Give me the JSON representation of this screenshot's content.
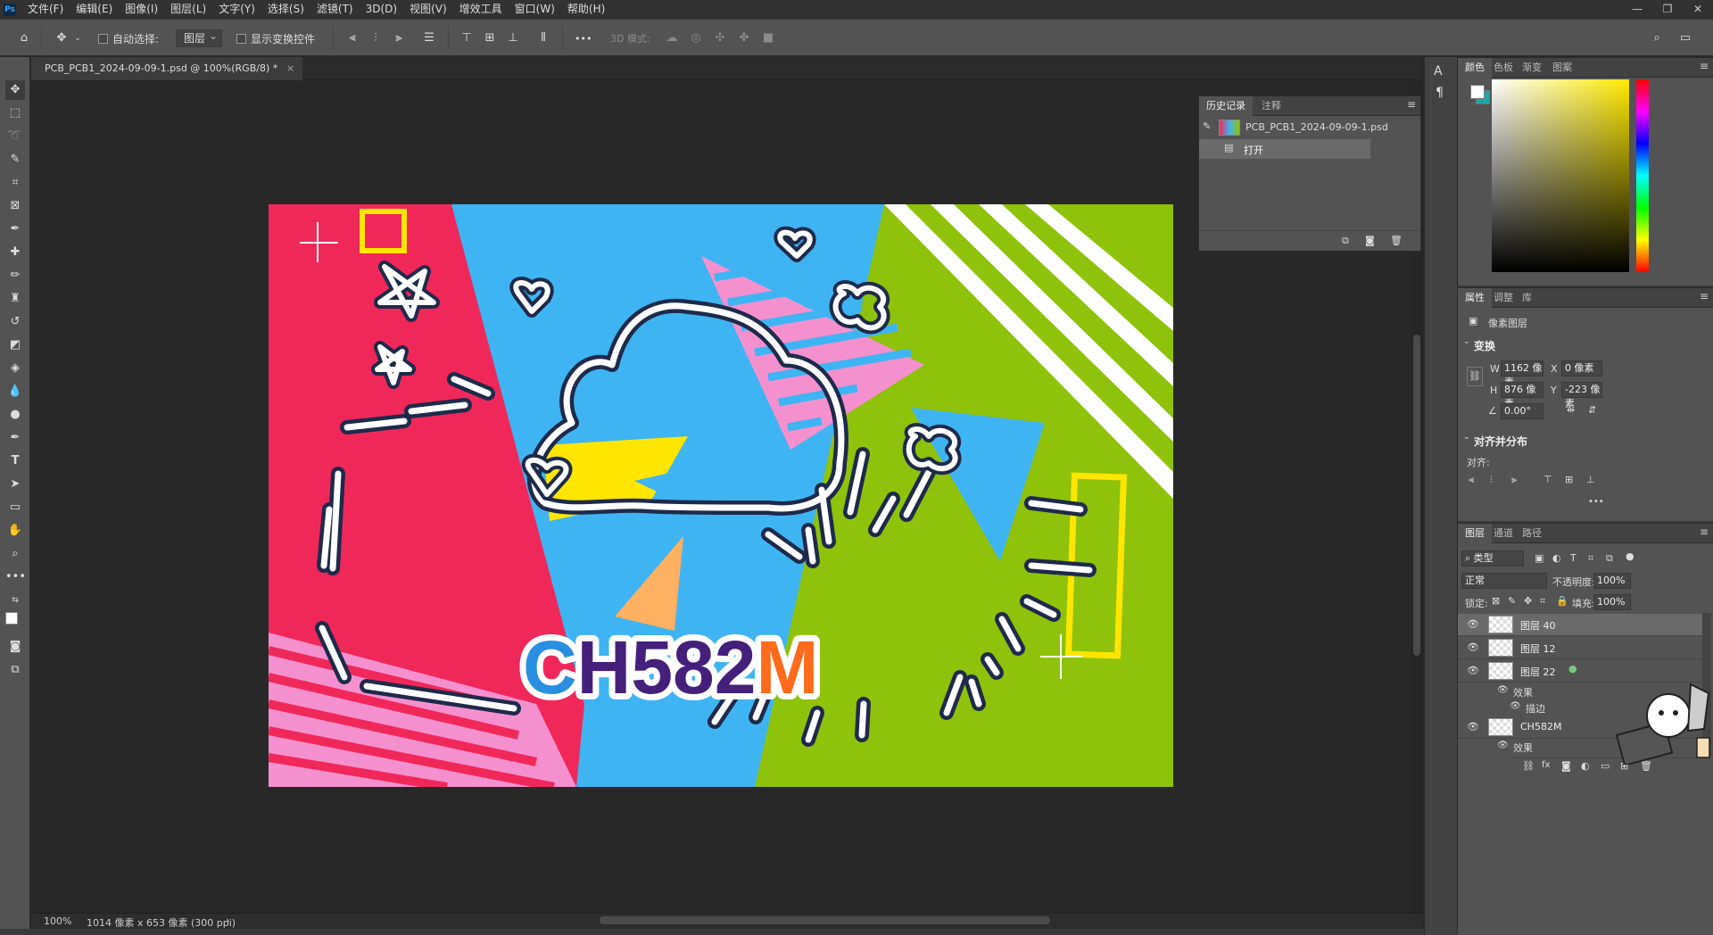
{
  "app": {
    "logo": "Ps"
  },
  "menu": [
    "文件(F)",
    "编辑(E)",
    "图像(I)",
    "图层(L)",
    "文字(Y)",
    "选择(S)",
    "滤镜(T)",
    "3D(D)",
    "视图(V)",
    "增效工具",
    "窗口(W)",
    "帮助(H)"
  ],
  "options": {
    "auto_select_label": "自动选择:",
    "auto_select_value": "图层",
    "show_transform_label": "显示变换控件",
    "more": "•••",
    "mode3d_label": "3D 模式:"
  },
  "document": {
    "tab_title": "PCB_PCB1_2024-09-09-1.psd @ 100%(RGB/8) *",
    "close": "×"
  },
  "artwork": {
    "title": "CH582M",
    "colors": {
      "pink": "#f0285a",
      "blue": "#3fb4f3",
      "green": "#8fc20a",
      "yellow": "#ffe600",
      "orange": "#ffb060",
      "lightpink": "#f590cf",
      "navy": "#1e2a4a",
      "purple": "#45207a",
      "orange_text": "#ff6b1a"
    }
  },
  "status": {
    "zoom": "100%",
    "info": "1014 像素 x 653 像素 (300 ppi)",
    "arrow": "›"
  },
  "history": {
    "tabs": [
      "历史记录",
      "注释"
    ],
    "snapshot": "PCB_PCB1_2024-09-09-1.psd",
    "steps": [
      "打开"
    ]
  },
  "color_panel": {
    "tabs": [
      "颜色",
      "色板",
      "渐变",
      "图案"
    ]
  },
  "properties": {
    "tabs": [
      "属性",
      "调整",
      "库"
    ],
    "layer_type": "像素图层",
    "transform_title": "变换",
    "w_label": "W",
    "w": "1162 像素",
    "h_label": "H",
    "h": "876 像素",
    "x_label": "X",
    "x": "0 像素",
    "y_label": "Y",
    "y": "-223 像素",
    "angle": "0.00°",
    "align_title": "对齐并分布",
    "align_label": "对齐:",
    "more": "•••"
  },
  "layers": {
    "tabs": [
      "图层",
      "通道",
      "路径"
    ],
    "filter": "类型",
    "blend": "正常",
    "opacity_label": "不透明度:",
    "opacity": "100%",
    "lock_label": "锁定:",
    "fill_label": "填充:",
    "fill": "100%",
    "rows": [
      {
        "name": "图层 40"
      },
      {
        "name": "图层 12"
      },
      {
        "name": "图层 22"
      },
      {
        "name": "效果"
      },
      {
        "name": "描边"
      },
      {
        "name": "CH582M"
      },
      {
        "name": "效果"
      }
    ]
  }
}
